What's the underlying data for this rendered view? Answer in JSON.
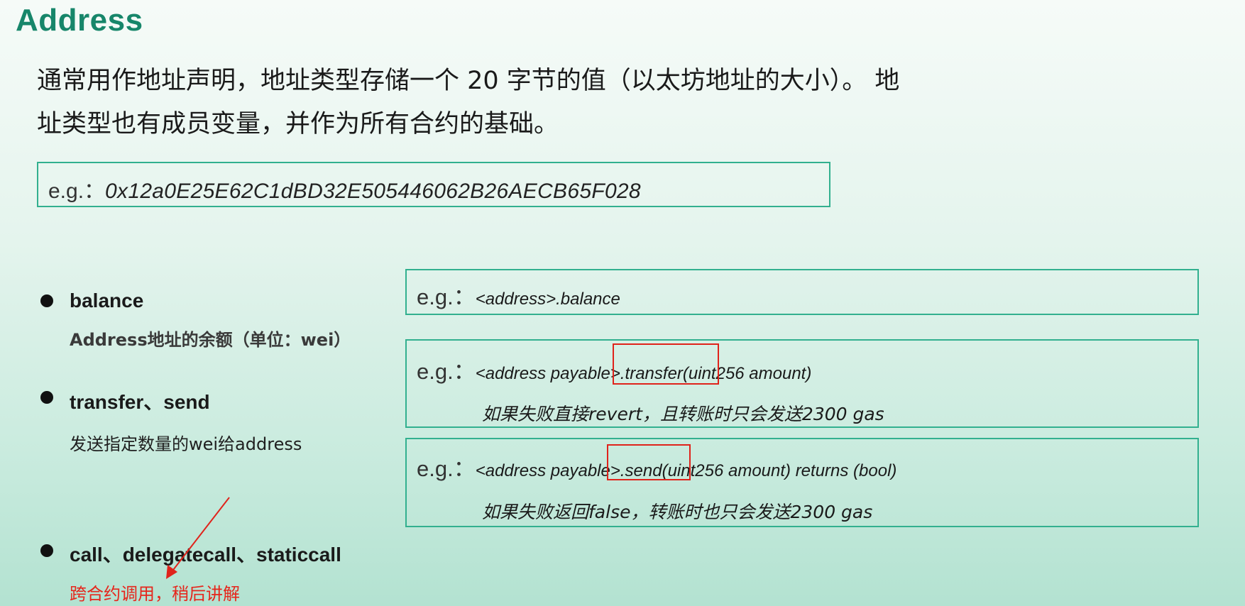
{
  "title": "Address",
  "intro": {
    "line1": "通常用作地址声明，地址类型存储一个 20 字节的值（以太坊地址的大小）。 地",
    "line2": "址类型也有成员变量，并作为所有合约的基础。"
  },
  "example": {
    "label": "e.g.：",
    "value": "0x12a0E25E62C1dBD32E505446062B26AECB65F028"
  },
  "members": [
    {
      "name": "balance",
      "desc": "Address地址的余额（单位：wei）"
    },
    {
      "name": "transfer、send",
      "desc": "发送指定数量的wei给address"
    },
    {
      "name": "call、delegatecall、staticcall",
      "desc": "跨合约调用，稍后讲解"
    }
  ],
  "code_examples": [
    {
      "label": "e.g.：",
      "code": "<address>.balance"
    },
    {
      "label": "e.g.：",
      "code": "<address payable>.transfer(uint256 amount)",
      "note": "如果失败直接revert，且转账时只会发送2300 gas"
    },
    {
      "label": "e.g.：",
      "code": "<address payable>.send(uint256 amount) returns (bool)",
      "note": "如果失败返回false，转账时也只会发送2300 gas"
    }
  ],
  "colors": {
    "title": "#17866a",
    "box_border": "#32b08f",
    "annotation_red": "#e0231b",
    "background_top": "#f6fbf8",
    "background_bottom": "#b3e2d1"
  }
}
